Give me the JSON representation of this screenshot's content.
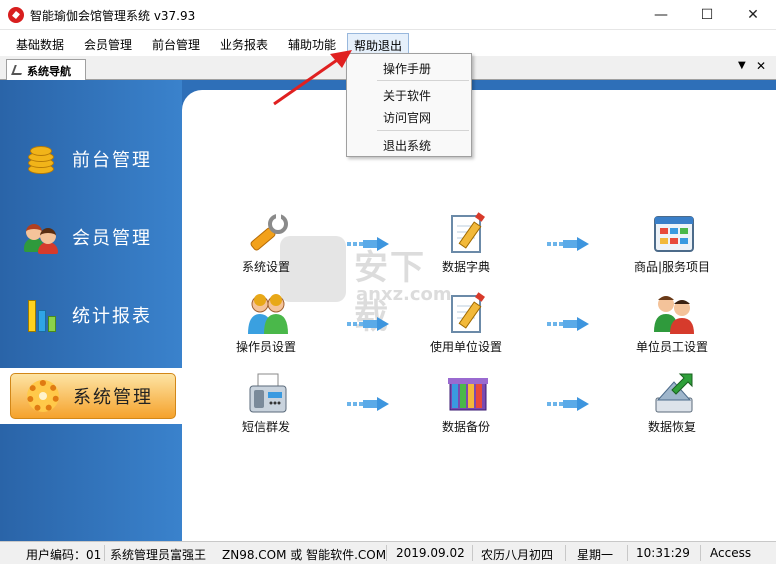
{
  "window": {
    "title": "智能瑜伽会馆管理系统 v37.93",
    "controls": [
      "minimize",
      "maximize",
      "close"
    ]
  },
  "menubar": {
    "items": [
      "基础数据",
      "会员管理",
      "前台管理",
      "业务报表",
      "辅助功能",
      "帮助退出"
    ],
    "active": "帮助退出"
  },
  "dropdown": {
    "items": [
      "操作手册",
      "关于软件",
      "访问官网",
      "退出系统"
    ]
  },
  "tabs": {
    "active_label": "系统导航"
  },
  "sidebar": {
    "items": [
      {
        "label": "前台管理",
        "icon": "coins-icon"
      },
      {
        "label": "会员管理",
        "icon": "members-icon"
      },
      {
        "label": "统计报表",
        "icon": "bar-chart-icon"
      },
      {
        "label": "系统管理",
        "icon": "gear-icon"
      }
    ],
    "active": "系统管理"
  },
  "functions": [
    {
      "label": "系统设置",
      "icon": "wrench-icon"
    },
    {
      "label": "数据字典",
      "icon": "notepad-icon"
    },
    {
      "label": "商品|服务项目",
      "icon": "grid-window-icon"
    },
    {
      "label": "操作员设置",
      "icon": "operators-icon"
    },
    {
      "label": "使用单位设置",
      "icon": "notepad-icon"
    },
    {
      "label": "单位员工设置",
      "icon": "staff-icon"
    },
    {
      "label": "短信群发",
      "icon": "fax-icon"
    },
    {
      "label": "数据备份",
      "icon": "books-icon"
    },
    {
      "label": "数据恢复",
      "icon": "restore-icon"
    }
  ],
  "watermark": {
    "title": "安下载",
    "subtitle": "anxz.com"
  },
  "statusbar": {
    "user_code": "用户编码：01",
    "company": "系统管理员富强王",
    "website": "ZN98.COM 或 智能软件.COM",
    "date": "2019.09.02",
    "lunar": "农历八月初四",
    "weekday": "星期一",
    "time": "10:31:29",
    "db": "Access"
  },
  "colors": {
    "sidebar_blue": "#2e6fb8",
    "active_orange": "#f5a22c",
    "arrow_blue": "#3d95de",
    "annotation_red": "#e02020"
  }
}
